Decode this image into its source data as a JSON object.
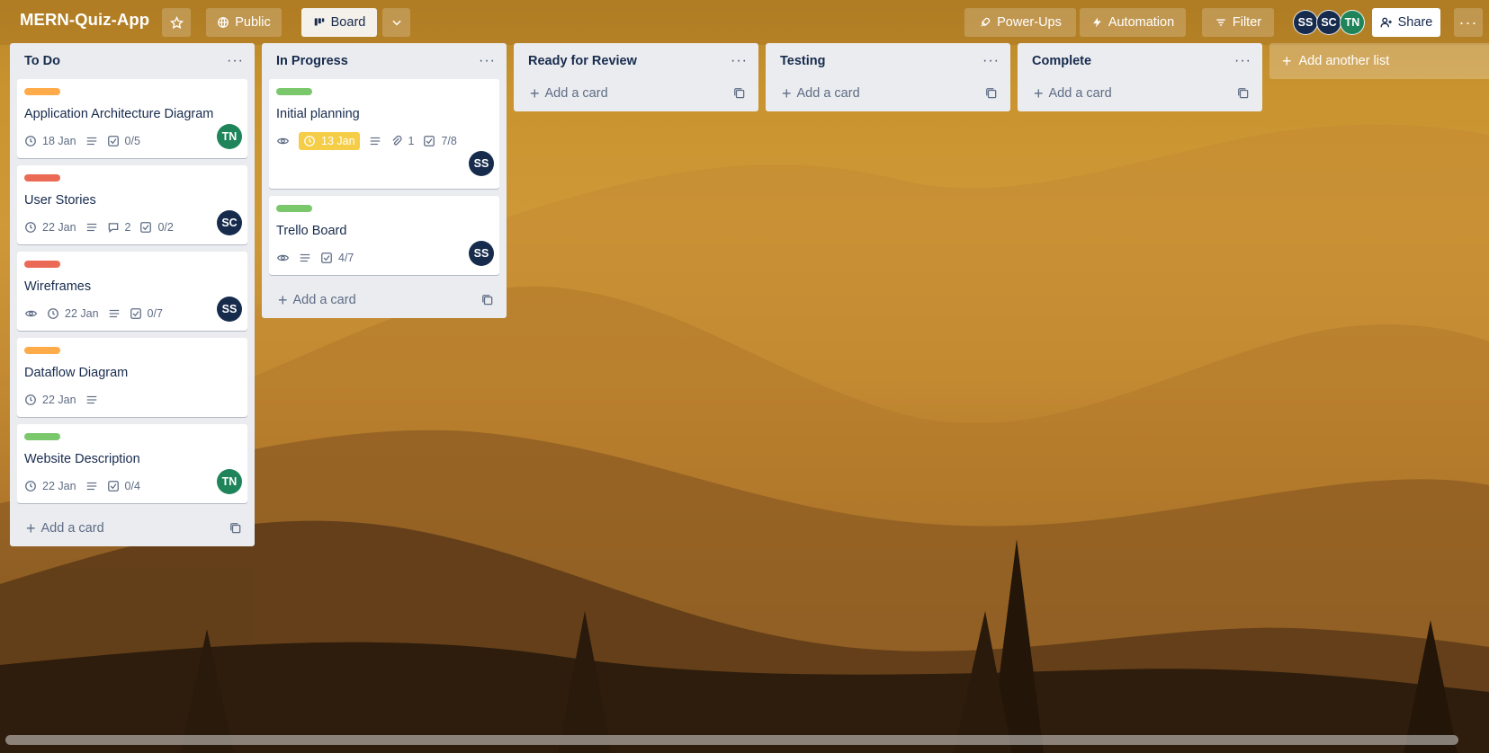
{
  "board": {
    "title": "MERN-Quiz-App",
    "visibility": "Public",
    "view": "Board",
    "actions": {
      "power_ups": "Power-Ups",
      "automation": "Automation",
      "filter": "Filter",
      "share": "Share"
    },
    "members": [
      {
        "initials": "SS",
        "color": "#172b4d"
      },
      {
        "initials": "SC",
        "color": "#172b4d"
      },
      {
        "initials": "TN",
        "color": "#1f845a"
      }
    ]
  },
  "lists": [
    {
      "title": "To Do",
      "add_card": "Add a card",
      "cards": [
        {
          "title": "Application Architecture Diagram",
          "label_color": "#ffab4a",
          "due": "18 Jan",
          "checklist": "0/5",
          "member": "TN",
          "member_color": "#1f845a"
        },
        {
          "title": "User Stories",
          "label_color": "#eb6a55",
          "due": "22 Jan",
          "comments": "2",
          "checklist": "0/2",
          "member": "SC",
          "member_color": "#172b4d"
        },
        {
          "title": "Wireframes",
          "label_color": "#eb6a55",
          "watch": true,
          "due": "22 Jan",
          "checklist": "0/7",
          "member": "SS",
          "member_color": "#172b4d"
        },
        {
          "title": "Dataflow Diagram",
          "label_color": "#ffab4a",
          "due": "22 Jan"
        },
        {
          "title": "Website Description",
          "label_color": "#7bc86c",
          "due": "22 Jan",
          "checklist": "0/4",
          "member": "TN",
          "member_color": "#1f845a"
        }
      ]
    },
    {
      "title": "In Progress",
      "add_card": "Add a card",
      "cards": [
        {
          "title": "Initial planning",
          "label_color": "#7bc86c",
          "watch": true,
          "due": "13 Jan",
          "due_highlight": "#f5cd47",
          "attachments": "1",
          "checklist": "7/8",
          "member": "SS",
          "member_color": "#172b4d"
        },
        {
          "title": "Trello Board",
          "label_color": "#7bc86c",
          "watch": true,
          "checklist": "4/7",
          "member": "SS",
          "member_color": "#172b4d"
        }
      ]
    },
    {
      "title": "Ready for Review",
      "add_card": "Add a card",
      "cards": []
    },
    {
      "title": "Testing",
      "add_card": "Add a card",
      "cards": []
    },
    {
      "title": "Complete",
      "add_card": "Add a card",
      "cards": []
    }
  ],
  "add_list": "Add another list"
}
